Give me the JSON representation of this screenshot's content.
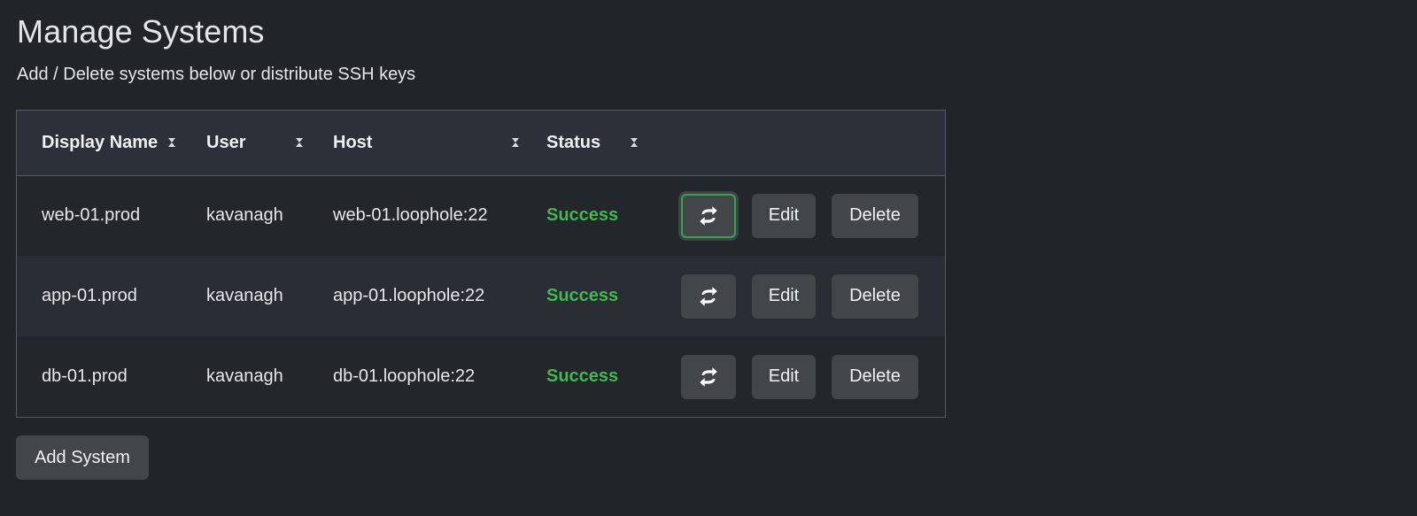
{
  "page": {
    "title": "Manage Systems",
    "subtitle": "Add / Delete systems below or distribute SSH keys"
  },
  "table": {
    "columns": [
      {
        "label": "Display Name",
        "sort_icon": "sort-icon"
      },
      {
        "label": "User",
        "sort_icon": "sort-icon"
      },
      {
        "label": "Host",
        "sort_icon": "sort-icon"
      },
      {
        "label": "Status",
        "sort_icon": "sort-icon"
      }
    ],
    "rows": [
      {
        "display_name": "web-01.prod",
        "user": "kavanagh",
        "host": "web-01.loophole:22",
        "status": "Success",
        "sync_focused": true
      },
      {
        "display_name": "app-01.prod",
        "user": "kavanagh",
        "host": "app-01.loophole:22",
        "status": "Success",
        "sync_focused": false
      },
      {
        "display_name": "db-01.prod",
        "user": "kavanagh",
        "host": "db-01.loophole:22",
        "status": "Success",
        "sync_focused": false
      }
    ],
    "actions": {
      "sync_icon": "sync-icon",
      "edit_label": "Edit",
      "delete_label": "Delete"
    }
  },
  "footer": {
    "add_label": "Add System"
  },
  "colors": {
    "background": "#222528",
    "header_background": "#2c3038",
    "status_success": "#3fb950",
    "button_background": "#434648",
    "focus_ring": "#2ea84a"
  }
}
